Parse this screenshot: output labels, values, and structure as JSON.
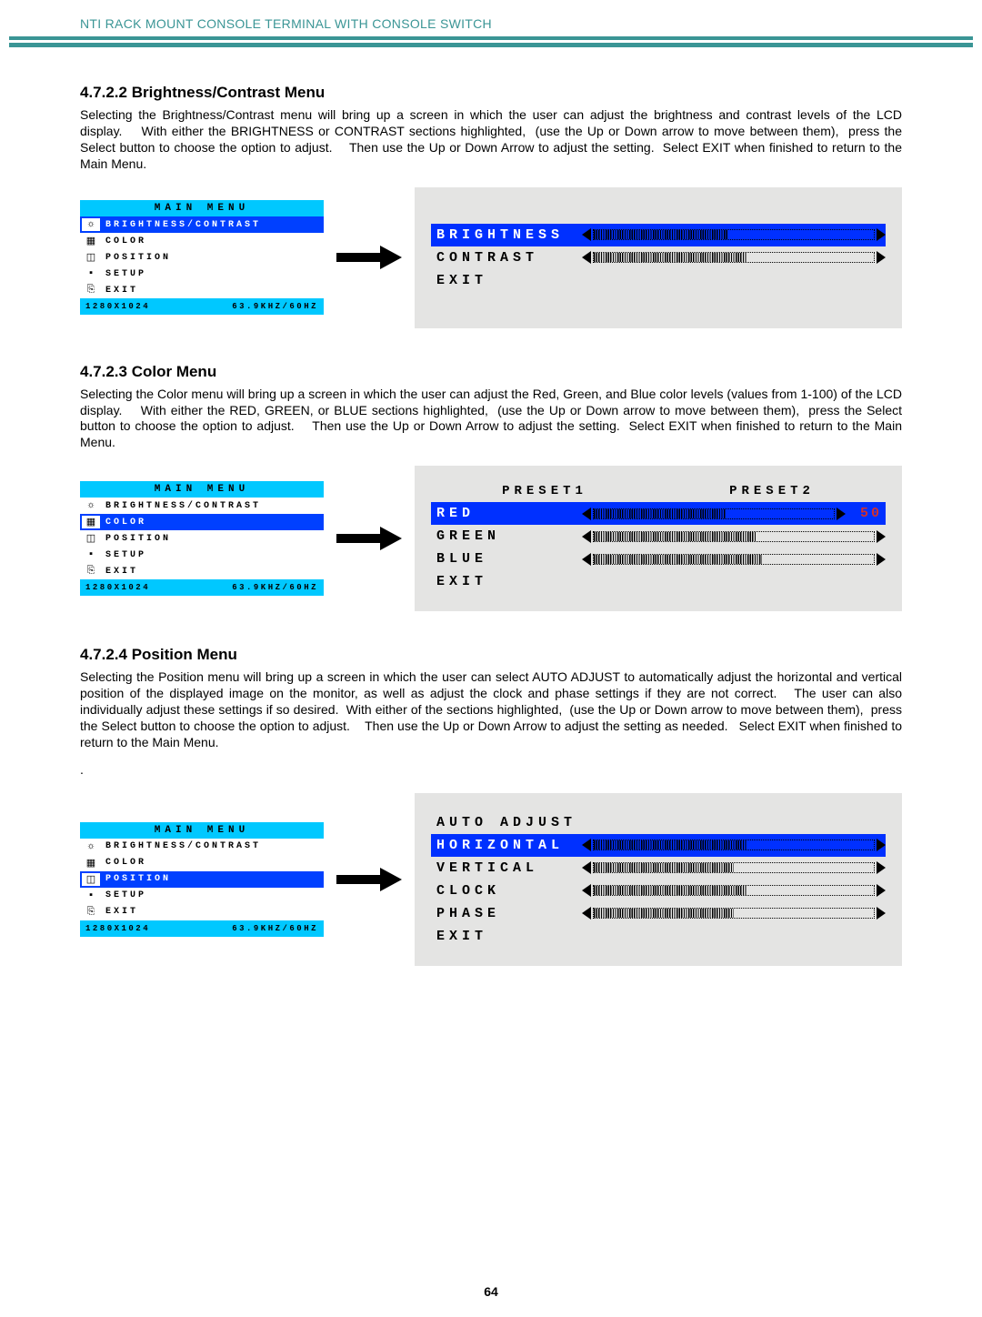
{
  "header": "NTI RACK MOUNT CONSOLE TERMINAL WITH CONSOLE SWITCH",
  "page_number": "64",
  "sections": {
    "s1": {
      "heading": "4.7.2.2 Brightness/Contrast Menu",
      "body": "Selecting the Brightness/Contrast menu will bring up a screen in which the user can adjust the brightness and contrast levels of the LCD display.    With either the BRIGHTNESS or CONTRAST sections highlighted,  (use the Up or Down arrow to move between them),  press the Select button to choose the option to adjust.    Then use the Up or Down Arrow to adjust the setting.  Select EXIT when finished to return to the Main Menu."
    },
    "s2": {
      "heading": "4.7.2.3 Color Menu",
      "body": "Selecting the Color menu will bring up a screen in which the user can adjust the Red, Green, and Blue color levels (values from 1-100) of the LCD display.    With either the RED, GREEN, or BLUE sections highlighted,  (use the Up or Down arrow to move between them),  press the Select button to choose the option to adjust.    Then use the Up or Down Arrow to adjust the setting.  Select EXIT when finished to return to the Main Menu."
    },
    "s3": {
      "heading": "4.7.2.4 Position Menu",
      "body": "Selecting the Position menu will bring up a screen in which the user can select AUTO ADJUST to automatically adjust the horizontal and vertical position of the displayed image on the monitor, as well as adjust the clock and phase settings if they are not correct.   The user can also individually adjust these settings if so desired.  With either of the sections highlighted,  (use the Up or Down arrow to move between them),  press the Select button to choose the option to adjust.    Then use the Up or Down Arrow to adjust the setting as needed.   Select EXIT when finished to return to the Main Menu."
    }
  },
  "main_menu": {
    "title": "MAIN MENU",
    "items": [
      {
        "icon": "sun-icon",
        "label": "BRIGHTNESS/CONTRAST"
      },
      {
        "icon": "palette-icon",
        "label": "COLOR"
      },
      {
        "icon": "position-icon",
        "label": "POSITION"
      },
      {
        "icon": "setup-icon",
        "label": "SETUP"
      },
      {
        "icon": "exit-icon",
        "label": "EXIT"
      }
    ],
    "status_left": "1280X1024",
    "status_right": "63.9KHZ/60HZ"
  },
  "submenus": {
    "brightness": {
      "rows": [
        {
          "label": "BRIGHTNESS",
          "selected": true,
          "fill": 48
        },
        {
          "label": "CONTRAST",
          "selected": false,
          "fill": 55
        },
        {
          "label": "EXIT",
          "selected": false,
          "type": "exit"
        }
      ]
    },
    "color": {
      "preset1": "PRESET1",
      "preset2": "PRESET2",
      "rows": [
        {
          "label": "RED",
          "selected": true,
          "label_color": "red",
          "fill": 55,
          "value": "50"
        },
        {
          "label": "GREEN",
          "selected": false,
          "fill": 58
        },
        {
          "label": "BLUE",
          "selected": false,
          "fill": 60
        },
        {
          "label": "EXIT",
          "selected": false,
          "type": "exit"
        }
      ]
    },
    "position": {
      "rows": [
        {
          "label": "AUTO ADJUST",
          "selected": false,
          "type": "text"
        },
        {
          "label": "HORIZONTAL",
          "selected": true,
          "fill": 55
        },
        {
          "label": "VERTICAL",
          "selected": false,
          "fill": 50
        },
        {
          "label": "CLOCK",
          "selected": false,
          "fill": 55
        },
        {
          "label": "PHASE",
          "selected": false,
          "fill": 50
        },
        {
          "label": "EXIT",
          "selected": false,
          "type": "exit"
        }
      ]
    }
  },
  "menu_selected_index": {
    "fig1": 0,
    "fig2": 1,
    "fig3": 2
  }
}
